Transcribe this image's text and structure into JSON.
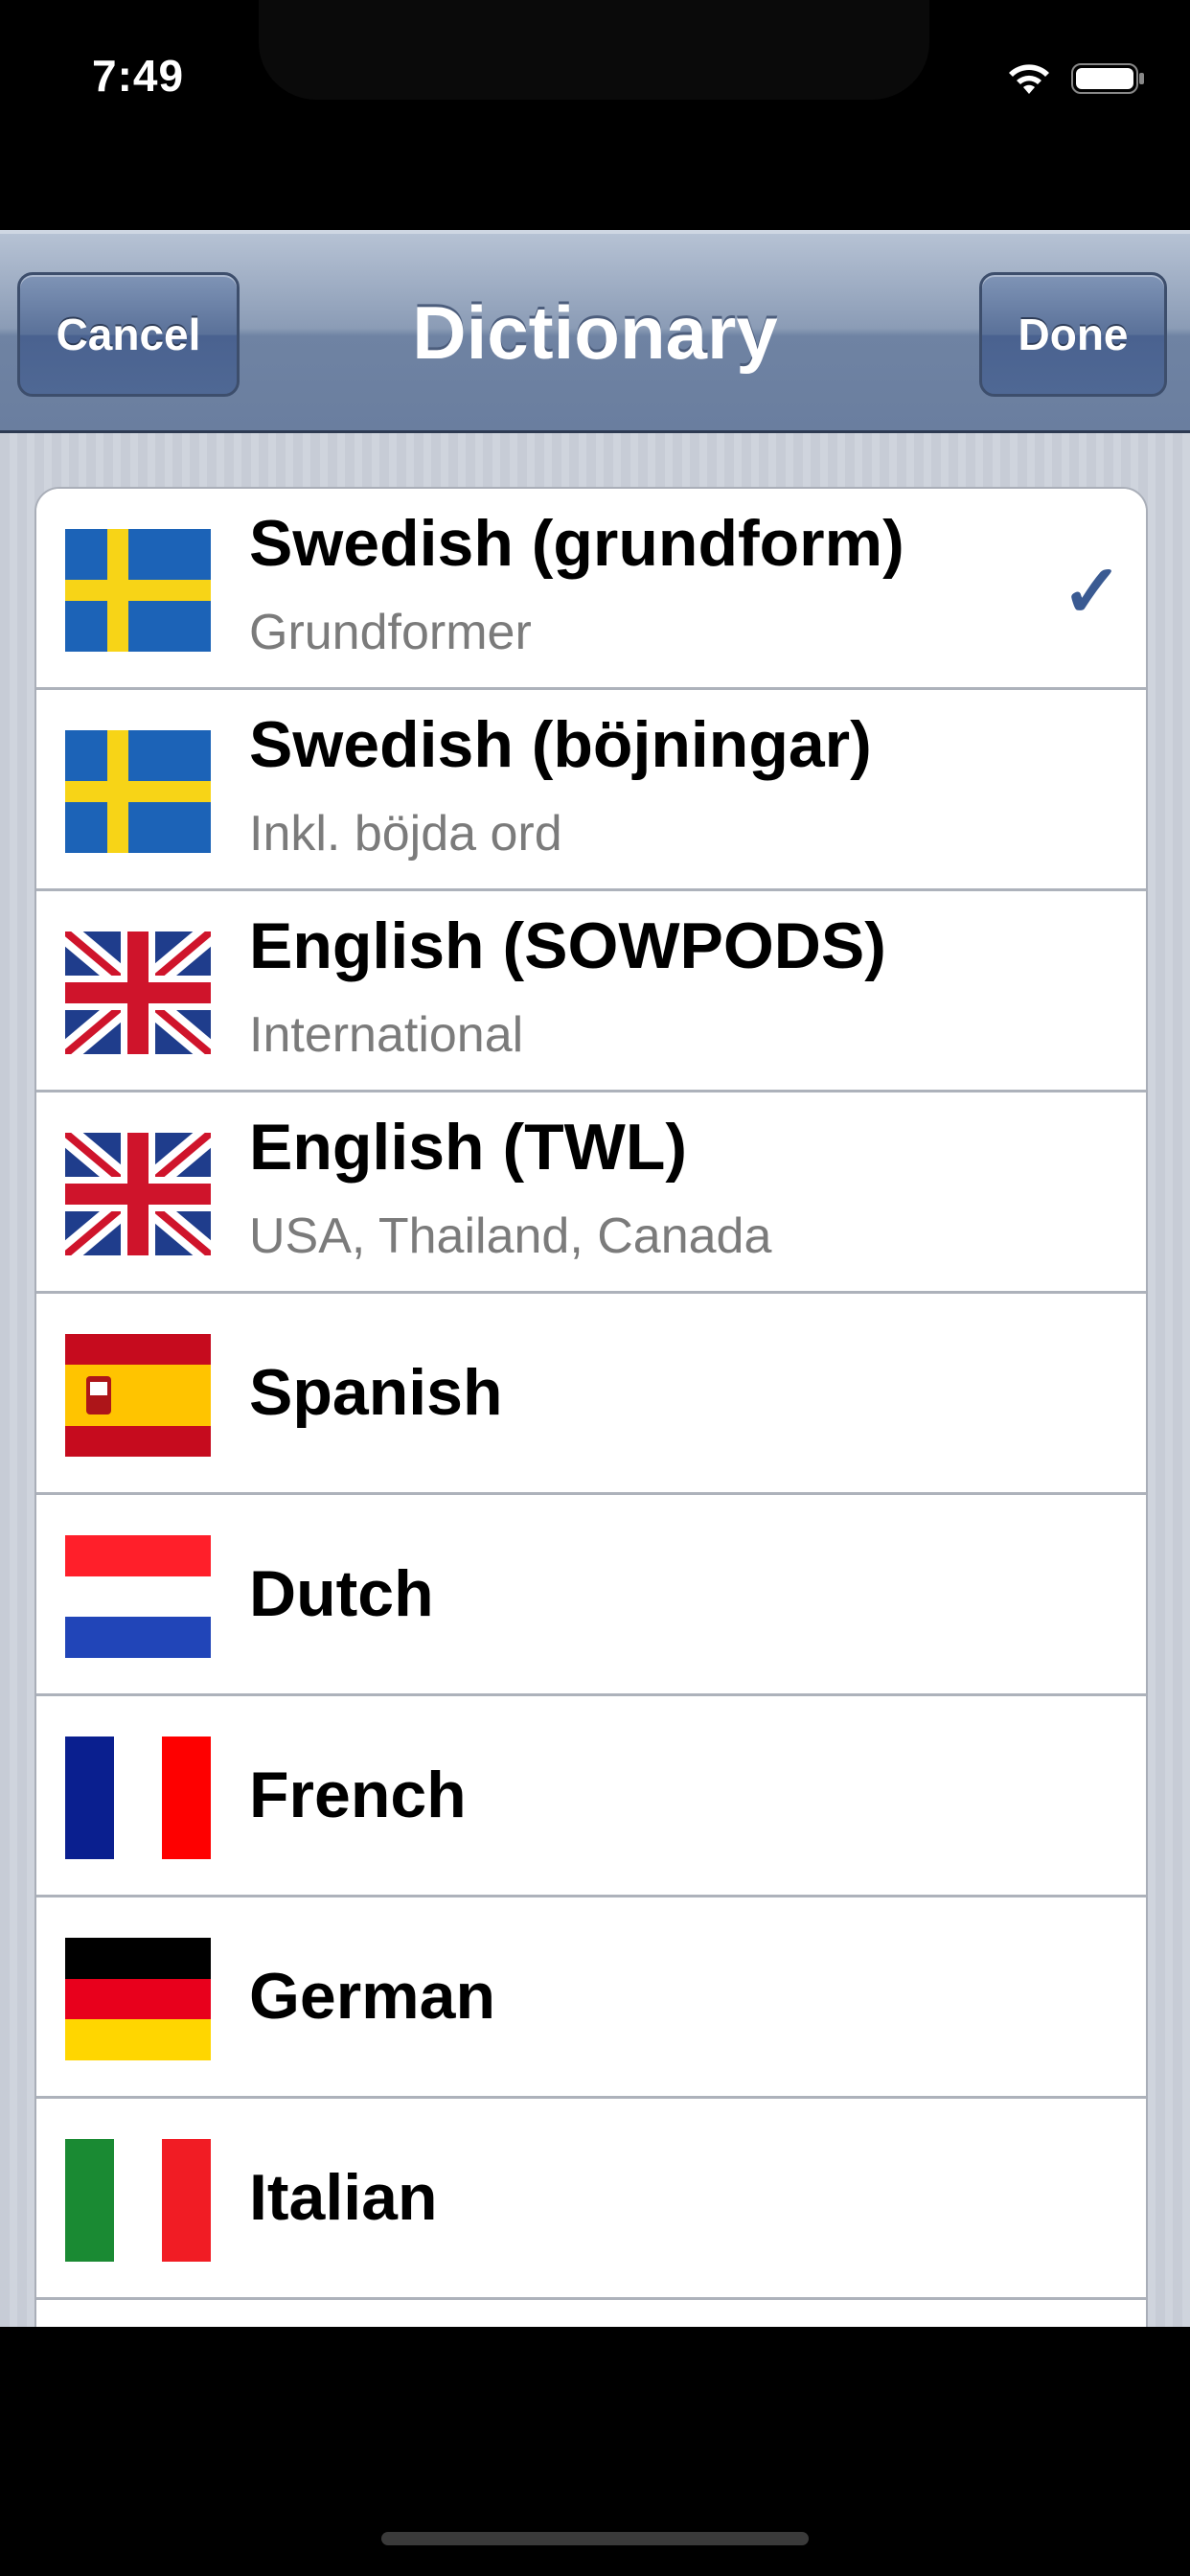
{
  "status_bar": {
    "time": "7:49"
  },
  "nav": {
    "title": "Dictionary",
    "cancel_label": "Cancel",
    "done_label": "Done"
  },
  "dictionaries": [
    {
      "title": "Swedish (grundform)",
      "subtitle": "Grundformer",
      "flag": "sweden-flag-icon",
      "selected": true
    },
    {
      "title": "Swedish (böjningar)",
      "subtitle": "Inkl. böjda ord",
      "flag": "sweden-flag-icon",
      "selected": false
    },
    {
      "title": "English (SOWPODS)",
      "subtitle": "International",
      "flag": "uk-flag-icon",
      "selected": false
    },
    {
      "title": "English (TWL)",
      "subtitle": "USA, Thailand, Canada",
      "flag": "uk-flag-icon",
      "selected": false
    },
    {
      "title": "Spanish",
      "flag": "spain-flag-icon",
      "selected": false
    },
    {
      "title": "Dutch",
      "flag": "netherlands-flag-icon",
      "selected": false
    },
    {
      "title": "French",
      "flag": "france-flag-icon",
      "selected": false
    },
    {
      "title": "German",
      "flag": "germany-flag-icon",
      "selected": false
    },
    {
      "title": "Italian",
      "flag": "italy-flag-icon",
      "selected": false
    }
  ],
  "checkmark": "✓",
  "colors": {
    "nav_tint": "#6f83a3",
    "checkmark": "#3a5a92"
  }
}
